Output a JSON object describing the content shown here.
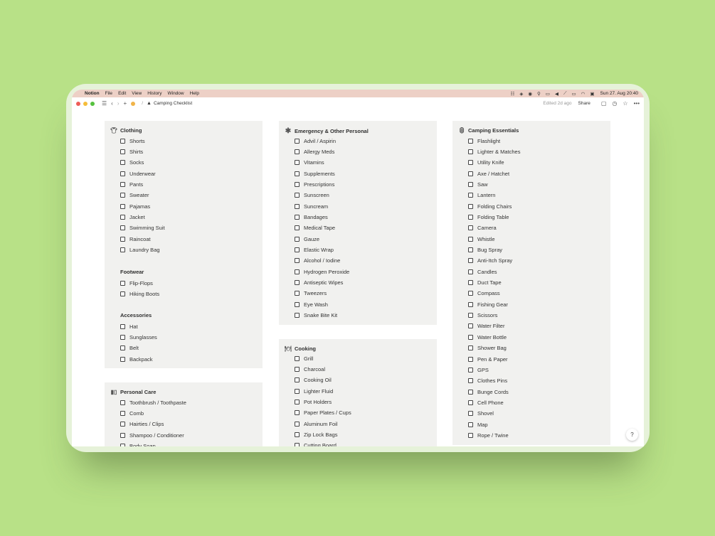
{
  "menubar": {
    "app_name": "Notion",
    "items": [
      "File",
      "Edit",
      "View",
      "History",
      "Window",
      "Help"
    ],
    "clock": "Sun 27. Aug 20:40",
    "status_icons": [
      "notion-icon",
      "layers-icon",
      "a-icon",
      "pin-icon",
      "screen-icon",
      "volume-icon",
      "mute-icon",
      "battery-icon",
      "wifi-icon",
      "control-center-icon"
    ]
  },
  "titlebar": {
    "breadcrumb_sep": "/",
    "page_title": "Camping Checklist",
    "edited": "Edited 2d ago",
    "share": "Share"
  },
  "colors": {
    "background": "#b8e187",
    "card": "#f1f1ef",
    "menubar": "#edd0c6"
  },
  "columns": [
    {
      "sections": [
        {
          "title": "Clothing",
          "icon": "tshirt-icon",
          "groups": [
            {
              "heading": "",
              "items": [
                "Shorts",
                "Shirts",
                "Socks",
                "Underwear",
                "Pants",
                "Sweater",
                "Pajamas",
                "Jacket",
                "Swimming Suit",
                "Raincoat",
                "Laundry Bag"
              ]
            },
            {
              "heading": "Footwear",
              "items": [
                "Flip-Flops",
                "Hiking Boots"
              ]
            },
            {
              "heading": "Accessories",
              "items": [
                "Hat",
                "Sunglasses",
                "Belt",
                "Backpack"
              ]
            }
          ]
        },
        {
          "title": "Personal Care",
          "icon": "toiletries-icon",
          "groups": [
            {
              "heading": "",
              "items": [
                "Toothbrush / Toothpaste",
                "Comb",
                "Hairties / Clips",
                "Shampoo / Conditioner",
                "Body Soap"
              ]
            }
          ]
        }
      ]
    },
    {
      "sections": [
        {
          "title": "Emergency & Other Personal",
          "icon": "asterisk-icon",
          "groups": [
            {
              "heading": "",
              "items": [
                "Advil / Aspirin",
                "Allergy Meds",
                "Vitamins",
                "Supplements",
                "Prescriptions",
                "Sunscreen",
                "Suncream",
                "Bandages",
                "Medical Tape",
                "Gauze",
                "Elastic Wrap",
                "Alcohol / Iodine",
                "Hydrogen Peroxide",
                "Antiseptic Wipes",
                "Tweezers",
                "Eye Wash",
                "Snake Bite Kit"
              ]
            }
          ]
        },
        {
          "title": "Cooking",
          "icon": "plate-icon",
          "groups": [
            {
              "heading": "",
              "items": [
                "Grill",
                "Charcoal",
                "Cooking Oil",
                "Lighter Fluid",
                "Pot Holders",
                "Paper Plates / Cups",
                "Aluminum Foil",
                "Zip Lock Bags",
                "Cutting Board"
              ]
            }
          ]
        }
      ]
    },
    {
      "sections": [
        {
          "title": "Camping Essentials",
          "icon": "lantern-icon",
          "groups": [
            {
              "heading": "",
              "items": [
                "Flashlight",
                "Lighter & Matches",
                "Utility Knife",
                "Axe / Hatchet",
                "Saw",
                "Lantern",
                "Folding Chairs",
                "Folding Table",
                "Camera",
                "Whistle",
                "Bug Spray",
                "Anti-Itch Spray",
                "Candles",
                "Duct Tape",
                "Compass",
                "Fishing Gear",
                "Scissors",
                "Water Filter",
                "Water Bottle",
                "Shower Bag",
                "Pen & Paper",
                "GPS",
                "Clothes Pins",
                "Bunge Cords",
                "Cell Phone",
                "Shovel",
                "Map",
                "Rope / Twine"
              ]
            }
          ]
        }
      ]
    }
  ],
  "help": "?"
}
